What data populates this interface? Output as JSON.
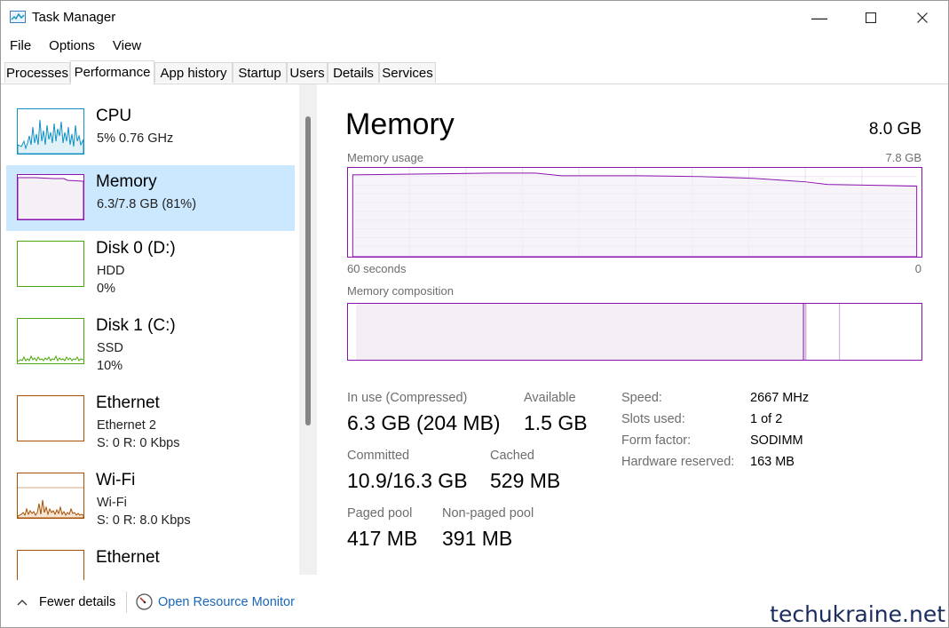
{
  "window": {
    "title": "Task Manager",
    "minimize_icon": "minimize-icon",
    "maximize_icon": "maximize-icon",
    "close_icon": "close-icon"
  },
  "menu": [
    {
      "label": "File"
    },
    {
      "label": "Options"
    },
    {
      "label": "View"
    }
  ],
  "tabs": [
    {
      "label": "Processes"
    },
    {
      "label": "Performance"
    },
    {
      "label": "App history"
    },
    {
      "label": "Startup"
    },
    {
      "label": "Users"
    },
    {
      "label": "Details"
    },
    {
      "label": "Services"
    }
  ],
  "active_tab": "Performance",
  "sidebar": {
    "items": [
      {
        "title": "CPU",
        "line1": "5%  0.76 GHz",
        "line2": "",
        "color": "#1191c1"
      },
      {
        "title": "Memory",
        "line1": "6.3/7.8 GB (81%)",
        "line2": "",
        "color": "#8b12ae",
        "selected": true
      },
      {
        "title": "Disk 0 (D:)",
        "line1": "HDD",
        "line2": "0%",
        "color": "#4da60c"
      },
      {
        "title": "Disk 1 (C:)",
        "line1": "SSD",
        "line2": "10%",
        "color": "#4da60c"
      },
      {
        "title": "Ethernet",
        "line1": "Ethernet 2",
        "line2": "S: 0  R: 0 Kbps",
        "color": "#a74f01"
      },
      {
        "title": "Wi-Fi",
        "line1": "Wi-Fi",
        "line2": "S: 0  R: 8.0 Kbps",
        "color": "#a74f01"
      },
      {
        "title": "Ethernet",
        "line1": "",
        "line2": "",
        "color": "#a74f01"
      }
    ]
  },
  "main": {
    "title": "Memory",
    "total": "8.0 GB",
    "usage_label": "Memory usage",
    "usage_max": "7.8 GB",
    "time_left": "60 seconds",
    "time_right": "0",
    "composition_label": "Memory composition",
    "stats": {
      "in_use_label": "In use (Compressed)",
      "in_use_value": "6.3 GB (204 MB)",
      "available_label": "Available",
      "available_value": "1.5 GB",
      "committed_label": "Committed",
      "committed_value": "10.9/16.3 GB",
      "cached_label": "Cached",
      "cached_value": "529 MB",
      "paged_label": "Paged pool",
      "paged_value": "417 MB",
      "nonpaged_label": "Non-paged pool",
      "nonpaged_value": "391 MB"
    },
    "details": [
      {
        "key": "Speed:",
        "value": "2667 MHz"
      },
      {
        "key": "Slots used:",
        "value": "1 of 2"
      },
      {
        "key": "Form factor:",
        "value": "SODIMM"
      },
      {
        "key": "Hardware reserved:",
        "value": "163 MB"
      }
    ]
  },
  "footer": {
    "fewer_details": "Fewer details",
    "open_resource_monitor": "Open Resource Monitor"
  },
  "watermark": "techukraine.net",
  "colors": {
    "memory": "#8b12ae",
    "cpu": "#1191c1",
    "disk": "#4da60c",
    "network": "#a74f01",
    "selection": "#cce8ff",
    "link": "#1a66b8"
  }
}
